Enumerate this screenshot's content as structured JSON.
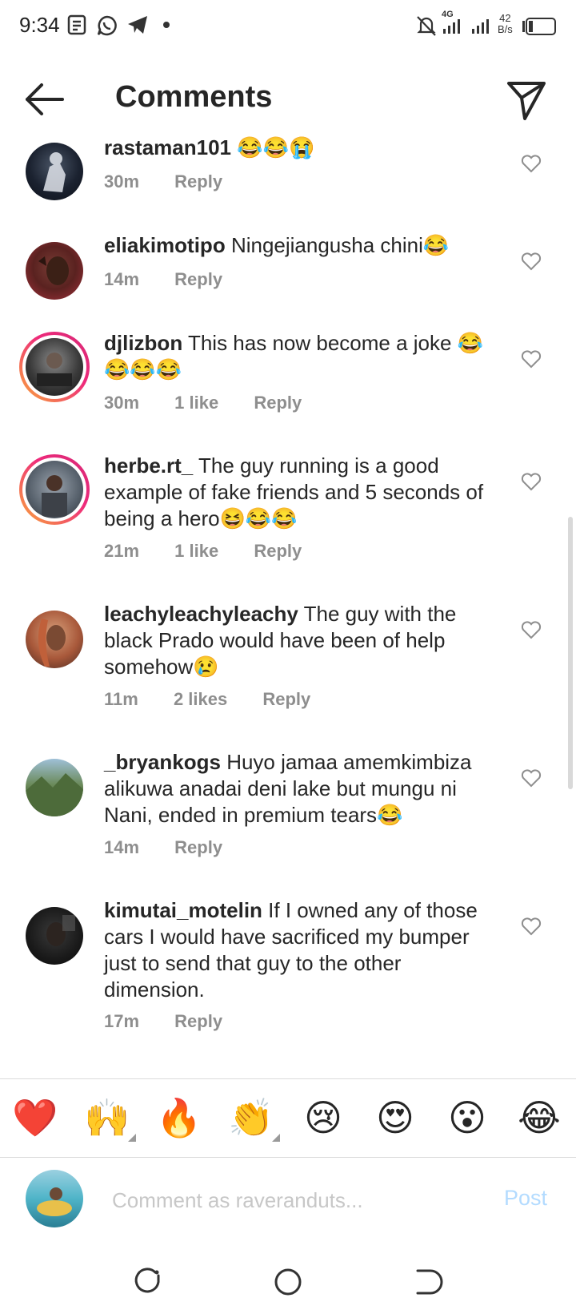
{
  "status_bar": {
    "time": "9:34",
    "network": "4G",
    "speed_value": "42",
    "speed_unit": "B/s",
    "icons": [
      "notes-icon",
      "whatsapp-icon",
      "telegram-icon",
      "dot-icon",
      "mute-icon",
      "signal-icon",
      "signal-icon",
      "battery-icon"
    ]
  },
  "header": {
    "title": "Comments"
  },
  "comments": [
    {
      "username": "rastaman101",
      "text": "😂😂😭",
      "time": "30m",
      "likes": "",
      "reply": "Reply"
    },
    {
      "username": "eliakimotipo",
      "text": "Ningejiangusha chini😂",
      "time": "14m",
      "likes": "",
      "reply": "Reply"
    },
    {
      "username": "djlizbon",
      "text": "This has now become a joke 😂😂😂😂",
      "time": "30m",
      "likes": "1 like",
      "reply": "Reply"
    },
    {
      "username": "herbe.rt_",
      "text": "The guy running is a good example of fake friends and 5 seconds of being a hero😆😂😂",
      "time": "21m",
      "likes": "1 like",
      "reply": "Reply"
    },
    {
      "username": "leachyleachyleachy",
      "text": "The guy with the black Prado would have been of help somehow😢",
      "time": "11m",
      "likes": "2 likes",
      "reply": "Reply"
    },
    {
      "username": "_bryankogs",
      "text": "Huyo jamaa amemkimbiza alikuwa anadai deni lake but mungu ni Nani, ended in premium tears😂",
      "time": "14m",
      "likes": "",
      "reply": "Reply"
    },
    {
      "username": "kimutai_motelin",
      "text": "If I owned any of those cars I would have sacrificed my bumper just to send that guy to the other dimension.",
      "time": "17m",
      "likes": "",
      "reply": "Reply"
    }
  ],
  "emoji_bar": [
    "❤️",
    "🙌",
    "🔥",
    "👏",
    "😢",
    "😍",
    "😮",
    "😂"
  ],
  "composer": {
    "placeholder": "Comment as raveranduts...",
    "post_label": "Post"
  },
  "colors": {
    "accent_post": "#b3dbff",
    "meta_text": "#8e8e8e",
    "story_ring_start": "#f9a93a",
    "story_ring_end": "#d62976"
  }
}
